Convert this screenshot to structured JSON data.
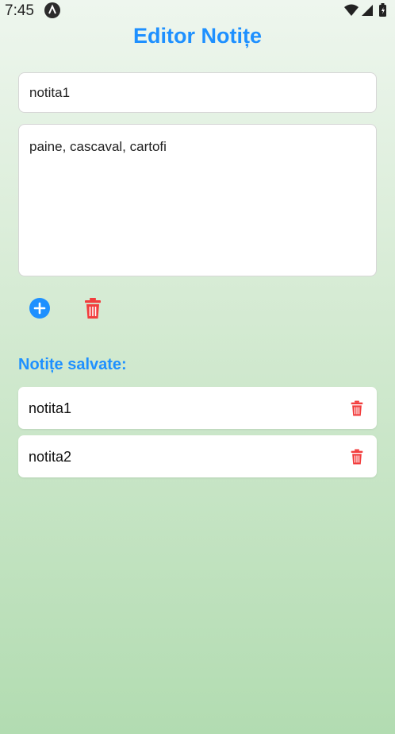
{
  "status_bar": {
    "time": "7:45"
  },
  "header": {
    "title": "Editor Notițe"
  },
  "editor": {
    "title_value": "notita1",
    "body_value": "paine, cascaval, cartofi"
  },
  "actions": {
    "add_icon": "plus-circle-icon",
    "delete_icon": "trash-icon"
  },
  "saved": {
    "heading": "Notițe salvate:",
    "notes": [
      {
        "label": "notita1"
      },
      {
        "label": "notita2"
      }
    ]
  },
  "colors": {
    "accent": "#1e90ff",
    "danger": "#f23d3d",
    "bg_top": "#eef6ee",
    "bg_bottom": "#b2dcb1"
  }
}
